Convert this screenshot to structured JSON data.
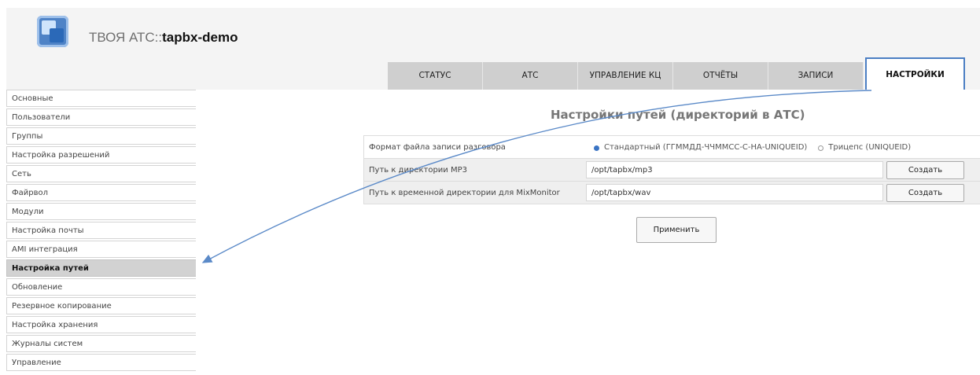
{
  "header": {
    "title_prefix": "ТВОЯ АТС::",
    "title_name": "tapbx-demo"
  },
  "tabs": [
    {
      "label": "СТАТУС"
    },
    {
      "label": "АТС"
    },
    {
      "label": "УПРАВЛЕНИЕ КЦ"
    },
    {
      "label": "ОТЧЁТЫ"
    },
    {
      "label": "ЗАПИСИ"
    },
    {
      "label": "НАСТРОЙКИ",
      "active": true
    }
  ],
  "sidebar": {
    "items": [
      {
        "label": "Основные"
      },
      {
        "label": "Пользователи"
      },
      {
        "label": "Группы"
      },
      {
        "label": "Настройка разрешений"
      },
      {
        "label": "Сеть"
      },
      {
        "label": "Файрвол"
      },
      {
        "label": "Модули"
      },
      {
        "label": "Настройка почты"
      },
      {
        "label": "AMI интеграция"
      },
      {
        "label": "Настройка путей",
        "active": true
      },
      {
        "label": "Обновление"
      },
      {
        "label": "Резервное копирование"
      },
      {
        "label": "Настройка хранения"
      },
      {
        "label": "Журналы систем"
      },
      {
        "label": "Управление"
      }
    ]
  },
  "main": {
    "title": "Настройки путей (директорий в АТС)",
    "format_row": {
      "label": "Формат файла записи разговора",
      "options": [
        {
          "label": "Стандартный (ГГММДД-ЧЧММСС-С-НА-UNIQUEID)",
          "selected": true
        },
        {
          "label": "Трицепс (UNIQUEID)",
          "selected": false
        }
      ]
    },
    "mp3_row": {
      "label": "Путь к директории MP3",
      "value": "/opt/tapbx/mp3",
      "button": "Создать"
    },
    "wav_row": {
      "label": "Путь к временной директории для MixMonitor",
      "value": "/opt/tapbx/wav",
      "button": "Создать"
    },
    "apply_button": "Применить"
  },
  "colors": {
    "accent": "#4b7ec3",
    "tab_bg": "#cfcfcf",
    "active_item_bg": "#d2d2d2"
  }
}
